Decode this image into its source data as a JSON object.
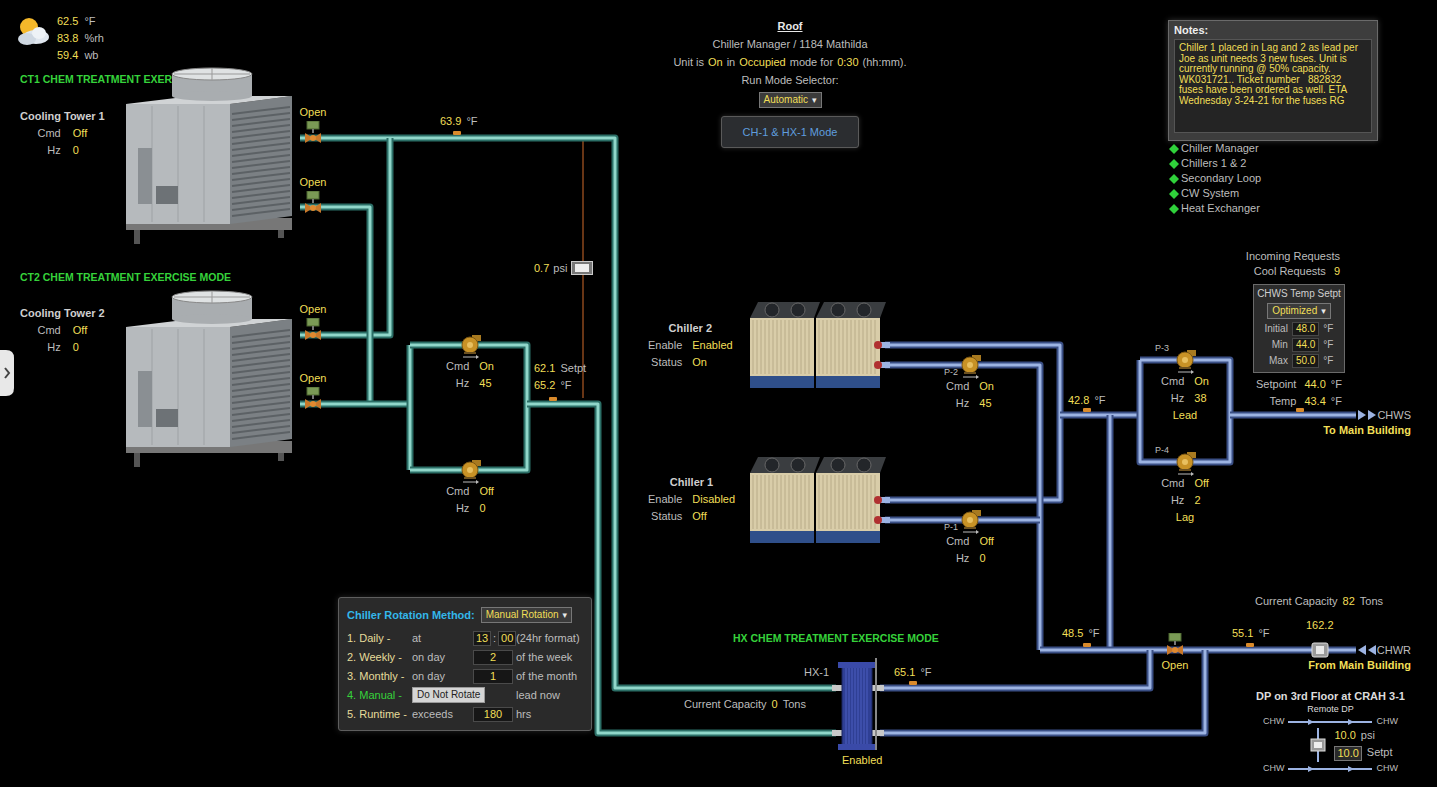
{
  "weather": {
    "readings": [
      {
        "value": "62.5",
        "unit": "°F"
      },
      {
        "value": "83.8",
        "unit": "%rh"
      },
      {
        "value": "59.4",
        "unit": "wb"
      }
    ]
  },
  "header": {
    "title": "Roof",
    "subtitle": "Chiller Manager / 1184 Mathilda",
    "status_parts": [
      {
        "text": "Unit is",
        "kind": "label"
      },
      {
        "text": "On",
        "kind": "value"
      },
      {
        "text": "in",
        "kind": "label"
      },
      {
        "text": "Occupied",
        "kind": "value"
      },
      {
        "text": "mode for",
        "kind": "label"
      },
      {
        "text": "0:30",
        "kind": "value"
      },
      {
        "text": "(hh:mm).",
        "kind": "label"
      }
    ],
    "run_mode_label": "Run Mode Selector:",
    "run_mode": {
      "value": "Automatic",
      "caret": "▾"
    },
    "mode_button": "CH-1 & HX-1 Mode"
  },
  "notes": {
    "title": "Notes:",
    "text": "Chiller 1 placed in Lag and 2 as lead per Joe as unit needs 3 new fuses. Unit is currently running @ 50% capacity. WK031721.. Ticket number   882832 fuses have been ordered as well. ETA Wednesday 3-24-21 for the fuses RG"
  },
  "links": [
    {
      "label": "Chiller Manager"
    },
    {
      "label": "Chillers 1 & 2"
    },
    {
      "label": "Secondary Loop"
    },
    {
      "label": "CW System"
    },
    {
      "label": "Heat Exchanger"
    }
  ],
  "cooling_towers": [
    {
      "banner": "CT1 CHEM TREATMENT EXERCISE MODE",
      "name": "Cooling Tower 1",
      "stats": [
        {
          "label": "Cmd",
          "value": "Off"
        },
        {
          "label": "Hz",
          "value": "0"
        }
      ],
      "valves": [
        {
          "label": "Open"
        },
        {
          "label": "Open"
        }
      ]
    },
    {
      "banner": "CT2 CHEM TREATMENT EXERCISE MODE",
      "name": "Cooling Tower 2",
      "stats": [
        {
          "label": "Cmd",
          "value": "Off"
        },
        {
          "label": "Hz",
          "value": "0"
        }
      ],
      "valves": [
        {
          "label": "Open"
        },
        {
          "label": "Open"
        }
      ]
    }
  ],
  "condenser_water": {
    "supply_temp": {
      "value": "63.9",
      "unit": "°F"
    },
    "dp": {
      "value": "0.7",
      "unit": "psi"
    },
    "pumps": [
      {
        "stats": [
          {
            "label": "Cmd",
            "value": "On"
          },
          {
            "label": "Hz",
            "value": "45"
          }
        ]
      },
      {
        "stats": [
          {
            "label": "Cmd",
            "value": "Off"
          },
          {
            "label": "Hz",
            "value": "0"
          }
        ]
      }
    ],
    "setpoint": {
      "value": "62.1",
      "unit": "Setpt"
    },
    "return_temp": {
      "value": "65.2",
      "unit": "°F"
    }
  },
  "chillers": [
    {
      "name": "Chiller 2",
      "stats": [
        {
          "label": "Enable",
          "value": "Enabled"
        },
        {
          "label": "Status",
          "value": "On"
        }
      ],
      "pump": {
        "tag": "P-2",
        "stats": [
          {
            "label": "Cmd",
            "value": "On"
          },
          {
            "label": "Hz",
            "value": "45"
          }
        ]
      }
    },
    {
      "name": "Chiller 1",
      "stats": [
        {
          "label": "Enable",
          "value": "Disabled"
        },
        {
          "label": "Status",
          "value": "Off"
        }
      ],
      "pump": {
        "tag": "P-1",
        "stats": [
          {
            "label": "Cmd",
            "value": "Off"
          },
          {
            "label": "Hz",
            "value": "0"
          }
        ]
      }
    }
  ],
  "secondary": {
    "supply_temp": {
      "value": "42.8",
      "unit": "°F"
    },
    "pumps": [
      {
        "tag": "P-3",
        "stats": [
          {
            "label": "Cmd",
            "value": "On"
          },
          {
            "label": "Hz",
            "value": "38"
          }
        ],
        "role": "Lead"
      },
      {
        "tag": "P-4",
        "stats": [
          {
            "label": "Cmd",
            "value": "Off"
          },
          {
            "label": "Hz",
            "value": "2"
          }
        ],
        "role": "Lag"
      }
    ],
    "requests": {
      "title": "Incoming Requests",
      "label": "Cool Requests",
      "value": "9"
    },
    "setpt_panel": {
      "title": "CHWS Temp Setpt",
      "mode": {
        "value": "Optimized",
        "caret": "▾"
      },
      "rows": [
        {
          "label": "Initial",
          "value": "48.0",
          "unit": "°F"
        },
        {
          "label": "Min",
          "value": "44.0",
          "unit": "°F"
        },
        {
          "label": "Max",
          "value": "50.0",
          "unit": "°F"
        }
      ]
    },
    "readings": [
      {
        "label": "Setpoint",
        "value": "44.0",
        "unit": "°F"
      },
      {
        "label": "Temp",
        "value": "43.4",
        "unit": "°F"
      }
    ],
    "supply_outlet": {
      "label": "CHWS",
      "destination": "To Main Building"
    },
    "capacity": {
      "label": "Current Capacity",
      "value": "82",
      "unit": "Tons"
    },
    "decoupler_temp": {
      "value": "48.5",
      "unit": "°F"
    },
    "return_valve": {
      "label": "Open"
    },
    "return_temp": {
      "value": "55.1",
      "unit": "°F"
    },
    "return_flow": {
      "value": "162.2"
    },
    "return_inlet": {
      "label": "CHWR",
      "destination": "From Main Building"
    }
  },
  "heat_exchanger": {
    "banner": "HX CHEM TREATMENT EXERCISE MODE",
    "tag": "HX-1",
    "temp": {
      "value": "65.1",
      "unit": "°F"
    },
    "capacity": {
      "label": "Current Capacity",
      "value": "0",
      "unit": "Tons"
    },
    "status": "Enabled"
  },
  "rotation": {
    "title": "Chiller Rotation Method:",
    "method": {
      "value": "Manual Rotation",
      "caret": "▾"
    },
    "rows": [
      {
        "kind": "time",
        "label": "1. Daily -",
        "prefix": "at",
        "hours": "13",
        "separator": ":",
        "minutes": "00",
        "suffix": "(24hr format)",
        "selected": false
      },
      {
        "kind": "field",
        "label": "2. Weekly -",
        "prefix": "on day",
        "value": "2",
        "suffix": "of the week",
        "selected": false
      },
      {
        "kind": "field",
        "label": "3. Monthly -",
        "prefix": "on day",
        "value": "1",
        "suffix": "of the month",
        "selected": false
      },
      {
        "kind": "button",
        "label": "4. Manual -",
        "button": "Do Not Rotate",
        "suffix": "lead now",
        "selected": true
      },
      {
        "kind": "field",
        "label": "5. Runtime -",
        "prefix": "exceeds",
        "value": "180",
        "suffix": "hrs",
        "selected": false
      }
    ]
  },
  "remote_dp": {
    "title": "DP on 3rd Floor at CRAH 3-1",
    "subtitle": "Remote DP",
    "lines": [
      {
        "left": "CHW",
        "right": "CHW"
      },
      {
        "left": "CHW",
        "right": "CHW"
      }
    ],
    "reading": {
      "value": "10.0",
      "unit": "psi"
    },
    "setpoint": {
      "value": "10.0",
      "label": "Setpt"
    }
  }
}
